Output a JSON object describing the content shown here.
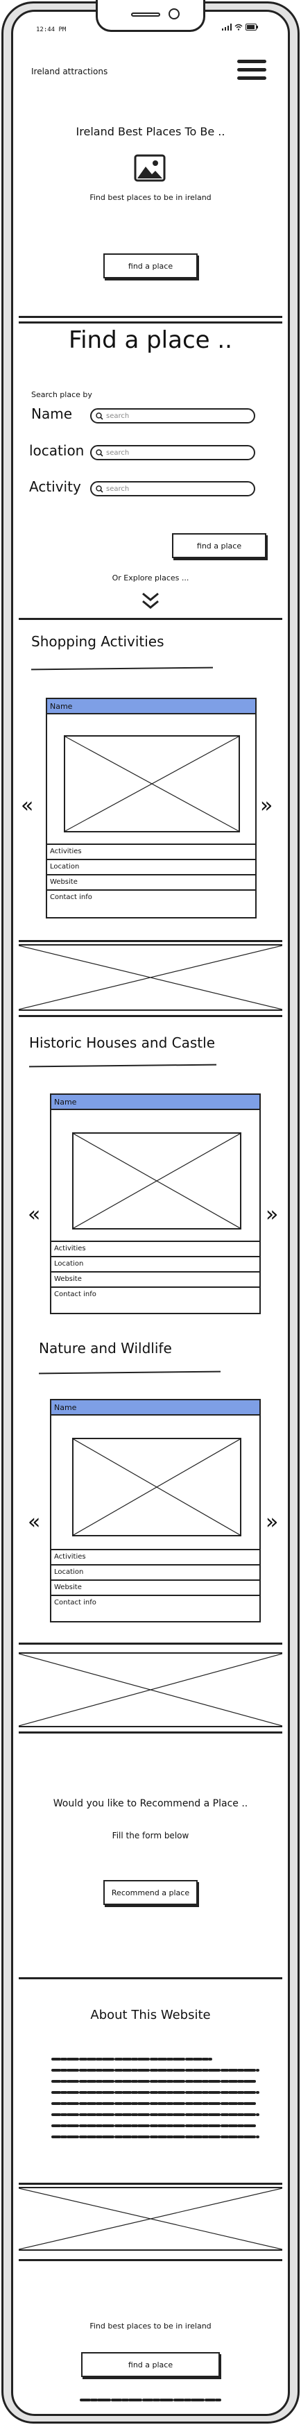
{
  "status_bar": {
    "time": "12:44 PM"
  },
  "header": {
    "title": "Ireland attractions"
  },
  "hero": {
    "title": "Ireland Best Places To Be ..",
    "subtitle": "Find best places to be in ireland",
    "button": "find a place"
  },
  "finder": {
    "title": "Find a place ..",
    "search_by": "Search place by",
    "fields": [
      {
        "label": "Name",
        "placeholder": "search"
      },
      {
        "label": "location",
        "placeholder": "search"
      },
      {
        "label": "Activity",
        "placeholder": "search"
      }
    ],
    "button": "find a place",
    "explore": "Or Explore places ..."
  },
  "sections": {
    "shopping": "Shopping Activities",
    "historic": "Historic Houses and Castle",
    "nature": "Nature and Wildlife"
  },
  "card": {
    "name": "Name",
    "rows": [
      "Activities",
      "Location",
      "Website",
      "Contact info"
    ]
  },
  "carousel": {
    "prev": "«",
    "next": "»"
  },
  "recommend": {
    "title": "Would you like to Recommend a Place ..",
    "subtitle": "Fill the form below",
    "button": "Recommend a place"
  },
  "about": {
    "title": "About This Website"
  },
  "footer": {
    "text": "Find best places to be in ireland",
    "button": "find a place"
  },
  "icons": {
    "menu": "hamburger-menu-icon",
    "image": "image-icon",
    "search": "search-icon",
    "explore": "double-chevron-down-icon",
    "signal": "signal-icon",
    "wifi": "wifi-icon",
    "battery": "battery-icon"
  },
  "colors": {
    "card_header": "#7e9fe6",
    "outline": "#222222"
  }
}
